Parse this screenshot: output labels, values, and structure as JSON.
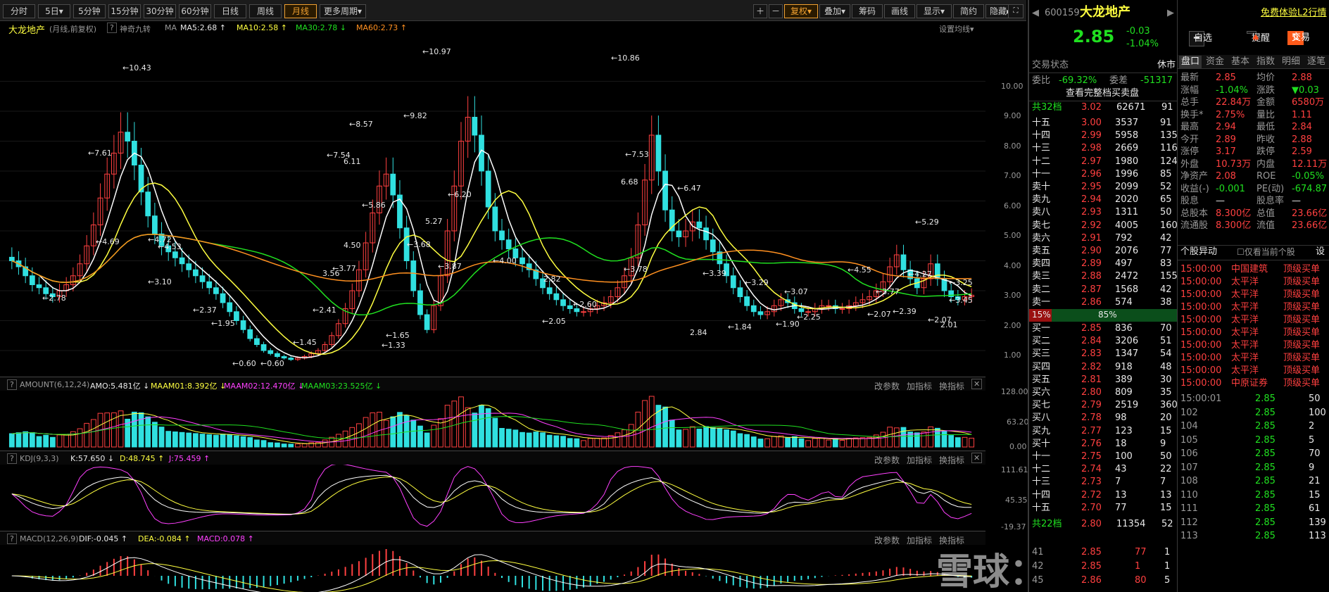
{
  "toolbar": {
    "periods": [
      "分时",
      "5日",
      "5分钟",
      "15分钟",
      "30分钟",
      "60分钟",
      "日线",
      "周线",
      "月线",
      "更多周期"
    ],
    "right": [
      "复权",
      "叠加",
      "筹码",
      "画线",
      "显示",
      "简约",
      "隐藏"
    ]
  },
  "chart": {
    "header": {
      "name": "大龙地产",
      "mode": "(月线,前复权)",
      "indicator": "神奇九转",
      "ma": "MA",
      "ma5": "MA5:2.68",
      "ma10": "MA10:2.58",
      "ma30": "MA30:2.78",
      "ma60": "MA60:2.73",
      "settings": "设置均线"
    },
    "price_ticks": [
      "10.00",
      "9.00",
      "8.00",
      "7.00",
      "6.00",
      "5.00",
      "4.00",
      "3.00",
      "2.00",
      "1.00"
    ],
    "annotations": [
      "10.43",
      "7.61",
      "4.69",
      "4.72",
      "4.53",
      "3.10",
      "2.78",
      "2.37",
      "1.95",
      "0.60",
      "10.97",
      "9.82",
      "8.57",
      "7.54",
      "6.11",
      "5.86",
      "4.50",
      "3.77",
      "3.56",
      "2.41",
      "1.65",
      "1.33",
      "0.60",
      "1.45",
      "10.86",
      "7.53",
      "6.68",
      "6.47",
      "6.20",
      "5.27",
      "3.87",
      "4.00",
      "3.78",
      "3.39",
      "2.60",
      "2.05",
      "2.84",
      "1.84",
      "1.90",
      "2.25",
      "2.07",
      "3.07",
      "5.29",
      "4.55",
      "4.27",
      "3.77",
      "3.45",
      "3.25",
      "2.39",
      "2.07",
      "2.01",
      "3.29",
      "2.82",
      "3.68"
    ],
    "amount": {
      "label": "AMOUNT(6,12,24)",
      "amo": "AMO:5.481亿",
      "m1": "MAAM01:8.392亿",
      "m2": "MAAM02:12.470亿",
      "m3": "MAAM03:23.525亿",
      "ticks": [
        "128.00",
        "63.20",
        "0.00"
      ]
    },
    "kdj": {
      "label": "KDJ(9,3,3)",
      "k": "K:57.650",
      "d": "D:48.745",
      "j": "J:75.459",
      "ticks": [
        "111.61",
        "45.35",
        "-19.37"
      ]
    },
    "macd": {
      "label": "MACD(12,26,9)",
      "dif": "DIF:-0.045",
      "dea": "DEA:-0.084",
      "macd": "MACD:0.078"
    },
    "panel_actions": [
      "改参数",
      "加指标",
      "换指标"
    ],
    "watermark": "雪球：ai价值投资"
  },
  "chart_data": {
    "type": "candlestick",
    "title": "大龙地产 (月线,前复权)",
    "ylim": [
      0.4,
      11.2
    ],
    "closes": [
      4.0,
      3.8,
      3.5,
      3.2,
      3.1,
      2.9,
      2.8,
      3.0,
      3.2,
      3.5,
      3.9,
      4.5,
      5.2,
      6.1,
      6.9,
      7.6,
      8.3,
      8.0,
      7.2,
      6.3,
      5.5,
      4.9,
      4.5,
      4.3,
      4.1,
      3.9,
      3.7,
      3.5,
      3.3,
      3.1,
      2.9,
      2.6,
      2.3,
      2.0,
      1.7,
      1.4,
      1.2,
      1.0,
      0.9,
      0.8,
      0.75,
      0.7,
      0.75,
      0.8,
      0.9,
      1.0,
      1.2,
      1.5,
      1.9,
      2.4,
      3.0,
      3.7,
      4.6,
      5.6,
      6.5,
      6.9,
      6.2,
      5.1,
      4.0,
      3.0,
      2.2,
      1.7,
      2.5,
      3.5,
      5.0,
      6.5,
      8.0,
      8.8,
      8.2,
      7.0,
      5.8,
      5.0,
      4.7,
      4.4,
      4.1,
      3.9,
      3.7,
      3.4,
      3.1,
      2.9,
      2.7,
      2.5,
      2.4,
      2.3,
      2.3,
      2.4,
      2.5,
      2.6,
      2.8,
      3.1,
      3.5,
      4.1,
      5.2,
      6.7,
      8.2,
      7.0,
      5.7,
      5.0,
      4.8,
      5.0,
      5.3,
      5.1,
      4.7,
      4.3,
      3.9,
      3.5,
      3.1,
      2.8,
      2.5,
      2.3,
      2.2,
      2.3,
      2.5,
      2.7,
      2.6,
      2.4,
      2.3,
      2.3,
      2.4,
      2.5,
      2.5,
      2.4,
      2.4,
      2.5,
      2.6,
      2.7,
      2.8,
      3.0,
      3.3,
      3.8,
      4.2,
      3.7,
      3.4,
      3.1,
      3.4,
      3.9,
      3.4,
      3.0,
      2.8,
      2.7,
      2.8,
      2.85
    ]
  },
  "orderbook": {
    "code": "600159",
    "name": "大龙地产",
    "price": "2.85",
    "chg": "-0.03",
    "pct": "-1.04%",
    "btn_watch": "自选",
    "btn_remind": "提醒",
    "btn_trade": "交易",
    "free_l2": "免费体验L2行情",
    "status_label": "交易状态",
    "status": "休市",
    "wb_label": "委比",
    "wb": "-69.32%",
    "wc_label": "委差",
    "wc": "-51317",
    "full_book": "查看完整档买卖盘",
    "sell_total": {
      "lbl": "共32档",
      "price": "3.02",
      "vol": "62671",
      "cnt": "91"
    },
    "asks": [
      [
        "十五",
        "3.00",
        "3537",
        "91"
      ],
      [
        "十四",
        "2.99",
        "5958",
        "135"
      ],
      [
        "十三",
        "2.98",
        "2669",
        "116"
      ],
      [
        "十二",
        "2.97",
        "1980",
        "124"
      ],
      [
        "十一",
        "2.96",
        "1996",
        "85"
      ],
      [
        "卖十",
        "2.95",
        "2099",
        "52"
      ],
      [
        "卖九",
        "2.94",
        "2020",
        "65"
      ],
      [
        "卖八",
        "2.93",
        "1311",
        "50"
      ],
      [
        "卖七",
        "2.92",
        "4005",
        "160"
      ],
      [
        "卖六",
        "2.91",
        "792",
        "42"
      ],
      [
        "卖五",
        "2.90",
        "2076",
        "77"
      ],
      [
        "卖四",
        "2.89",
        "497",
        "83"
      ],
      [
        "卖三",
        "2.88",
        "2472",
        "155"
      ],
      [
        "卖二",
        "2.87",
        "1568",
        "42"
      ],
      [
        "卖一",
        "2.86",
        "574",
        "38"
      ]
    ],
    "ratio": {
      "left": "15%",
      "right": "85%"
    },
    "bids": [
      [
        "买一",
        "2.85",
        "836",
        "70"
      ],
      [
        "买二",
        "2.84",
        "3206",
        "51"
      ],
      [
        "买三",
        "2.83",
        "1347",
        "54"
      ],
      [
        "买四",
        "2.82",
        "918",
        "48"
      ],
      [
        "买五",
        "2.81",
        "389",
        "30"
      ],
      [
        "买六",
        "2.80",
        "809",
        "35"
      ],
      [
        "买七",
        "2.79",
        "2519",
        "360"
      ],
      [
        "买八",
        "2.78",
        "98",
        "20"
      ],
      [
        "买九",
        "2.77",
        "123",
        "15"
      ],
      [
        "买十",
        "2.76",
        "18",
        "9"
      ],
      [
        "十一",
        "2.75",
        "100",
        "50"
      ],
      [
        "十二",
        "2.74",
        "43",
        "22"
      ],
      [
        "十三",
        "2.73",
        "7",
        "7"
      ],
      [
        "十四",
        "2.72",
        "13",
        "13"
      ],
      [
        "十五",
        "2.70",
        "77",
        "15"
      ]
    ],
    "buy_total": {
      "lbl": "共22档",
      "price": "2.80",
      "vol": "11354",
      "cnt": "52"
    },
    "ticks": [
      [
        "41",
        "2.85",
        "77",
        "1"
      ],
      [
        "42",
        "2.85",
        "1",
        "1"
      ],
      [
        "45",
        "2.86",
        "80",
        "5"
      ]
    ]
  },
  "quotes": {
    "tabs": [
      "盘口",
      "资金",
      "基本",
      "指数",
      "明细",
      "逐笔"
    ],
    "rows": [
      [
        "最新",
        "2.85",
        "均价",
        "2.88"
      ],
      [
        "涨幅",
        "-1.04%",
        "涨跌",
        "▼0.03"
      ],
      [
        "总手",
        "22.84万",
        "金额",
        "6580万"
      ],
      [
        "换手*",
        "2.75%",
        "量比",
        "1.11"
      ],
      [
        "最高",
        "2.94",
        "最低",
        "2.84"
      ],
      [
        "今开",
        "2.89",
        "昨收",
        "2.88"
      ],
      [
        "涨停",
        "3.17",
        "跌停",
        "2.59"
      ],
      [
        "外盘",
        "10.73万",
        "内盘",
        "12.11万"
      ],
      [
        "净资产",
        "2.08",
        "ROE",
        "-0.05%"
      ],
      [
        "收益(-)",
        "-0.001",
        "PE(动)",
        "-674.87"
      ],
      [
        "股息",
        "—",
        "股息率",
        "—"
      ],
      [
        "总股本",
        "8.300亿",
        "总值",
        "23.66亿"
      ],
      [
        "流通股",
        "8.300亿",
        "流值",
        "23.66亿"
      ]
    ],
    "alerts_title": "个股异动",
    "alerts_filter": "仅看当前个股",
    "alerts_set": "设",
    "alerts": [
      [
        "15:00:00",
        "中国建筑",
        "顶级买单"
      ],
      [
        "15:00:00",
        "太平洋",
        "顶级买单"
      ],
      [
        "15:00:00",
        "太平洋",
        "顶级买单"
      ],
      [
        "15:00:00",
        "太平洋",
        "顶级买单"
      ],
      [
        "15:00:00",
        "太平洋",
        "顶级买单"
      ],
      [
        "15:00:00",
        "太平洋",
        "顶级买单"
      ],
      [
        "15:00:00",
        "太平洋",
        "顶级买单"
      ],
      [
        "15:00:00",
        "太平洋",
        "顶级买单"
      ],
      [
        "15:00:00",
        "太平洋",
        "顶级买单"
      ],
      [
        "15:00:00",
        "中原证券",
        "顶级买单"
      ]
    ],
    "trades": [
      [
        "15:00:01",
        "2.85",
        "50"
      ],
      [
        "102",
        "2.85",
        "100"
      ],
      [
        "104",
        "2.85",
        "2"
      ],
      [
        "105",
        "2.85",
        "5"
      ],
      [
        "106",
        "2.85",
        "70"
      ],
      [
        "107",
        "2.85",
        "9"
      ],
      [
        "108",
        "2.85",
        "21"
      ],
      [
        "110",
        "2.85",
        "15"
      ],
      [
        "111",
        "2.85",
        "61"
      ],
      [
        "112",
        "2.85",
        "139"
      ],
      [
        "113",
        "2.85",
        "113"
      ]
    ]
  }
}
